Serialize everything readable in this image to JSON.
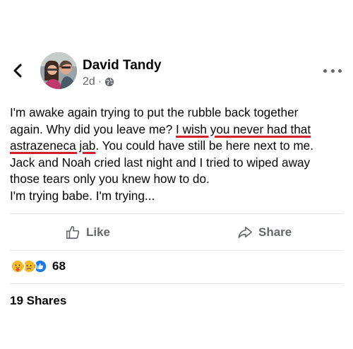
{
  "header": {
    "author_name": "David Tandy",
    "timestamp": "2d",
    "separator": "·",
    "privacy_icon": "globe-icon"
  },
  "post": {
    "lines": [
      "I'm awake again trying to put the rubble back together",
      "again. Why did you leave me? ",
      "I wish you never had that",
      "astrazeneca jab",
      ". You could have still be here next to me.",
      "Jack and Noah cried last night and I tried to wiped away",
      "those tears only you knew how to do.",
      "I'm trying babe. I'm trying..."
    ],
    "highlight_color": "#d0202a"
  },
  "actions": {
    "like_label": "Like",
    "share_label": "Share"
  },
  "engagement": {
    "reaction_icons": [
      "care-icon",
      "sad-icon",
      "like-icon"
    ],
    "reaction_count": "68",
    "shares_text": "19 Shares"
  },
  "colors": {
    "text_primary": "#050505",
    "text_secondary": "#65676b",
    "divider": "#e4e6eb",
    "like_blue": "#1877f2",
    "reaction_yellow": "#f7b928"
  }
}
